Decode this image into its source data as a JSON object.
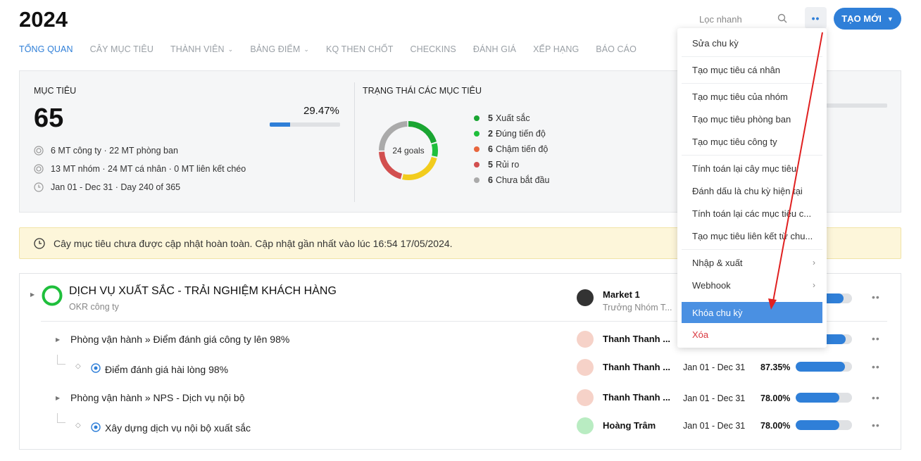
{
  "header": {
    "title": "2024",
    "search_placeholder": "Lọc nhanh",
    "more_label": "••",
    "create_label": "TẠO MỚI"
  },
  "tabs": [
    {
      "label": "TỔNG QUAN",
      "active": true
    },
    {
      "label": "CÂY MỤC TIÊU"
    },
    {
      "label": "THÀNH VIÊN",
      "dropdown": true
    },
    {
      "label": "BẢNG ĐIỂM",
      "dropdown": true
    },
    {
      "label": "KQ THEN CHỐT"
    },
    {
      "label": "CHECKINS"
    },
    {
      "label": "ĐÁNH GIÁ"
    },
    {
      "label": "XẾP HẠNG"
    },
    {
      "label": "BÁO CÁO"
    }
  ],
  "summary": {
    "goals_label": "MỤC TIÊU",
    "goals_count": "65",
    "progress_pct": "29.47%",
    "progress_value": 0.2947,
    "meta": [
      "6 MT công ty · 22 MT phòng ban",
      "13 MT nhóm · 24 MT cá nhân · 0 MT liên kết chéo",
      "Jan 01 - Dec 31 · Day 240 of 365"
    ],
    "status_label": "TRẠNG THÁI CÁC MỤC TIÊU",
    "donut_center": "24 goals",
    "status_items": [
      {
        "count": "5",
        "label": "Xuất sắc",
        "color": "#1aa532"
      },
      {
        "count": "2",
        "label": "Đúng tiến độ",
        "color": "#1fbf3c"
      },
      {
        "count": "6",
        "label": "Chậm tiến độ",
        "color": "#e8663d"
      },
      {
        "count": "5",
        "label": "Rủi ro",
        "color": "#d24f4f"
      },
      {
        "count": "6",
        "label": "Chưa bắt đầu",
        "color": "#aaaaaa"
      }
    ]
  },
  "notice": {
    "text": "Cây mục tiêu chưa được cập nhật hoàn toàn. Cập nhật gần nhất vào lúc 16:54 17/05/2024."
  },
  "okr": {
    "title": "DỊCH VỤ XUẤT SẮC - TRẢI NGHIỆM KHÁCH HÀNG",
    "subtitle": "OKR công ty",
    "owner": "Market 1",
    "owner_role": "Trưởng Nhóm T...",
    "rows": [
      {
        "text": "Phòng vận hành » Điểm đánh giá công ty lên 98%",
        "owner": "Thanh Thanh ...",
        "date": "",
        "pct": "",
        "progress": 0.89
      },
      {
        "text": "Điểm đánh giá hài lòng 98%",
        "owner": "Thanh Thanh ...",
        "date": "Jan 01 - Dec 31",
        "pct": "87.35%",
        "progress": 0.8735
      },
      {
        "text": "Phòng vận hành » NPS - Dịch vụ nội bộ",
        "owner": "Thanh Thanh ...",
        "date": "Jan 01 - Dec 31",
        "pct": "78.00%",
        "progress": 0.78
      },
      {
        "text": "Xây dựng dịch vụ nội bộ xuất sắc",
        "owner": "Hoàng Trâm",
        "date": "Jan 01 - Dec 31",
        "pct": "78.00%",
        "progress": 0.78
      }
    ],
    "header_progress": 0.85
  },
  "menu": {
    "items": [
      "Sửa chu kỳ",
      "Tạo mục tiêu cá nhân",
      "Tạo mục tiêu của nhóm",
      "Tạo mục tiêu phòng ban",
      "Tạo mục tiêu công ty",
      "Tính toán lại cây mục tiêu",
      "Đánh dấu là chu kỳ hiện tại",
      "Tính toán lại các mục tiêu c...",
      "Tạo mục tiêu liên kết từ chu...",
      "Nhập & xuất",
      "Webhook",
      "Khóa chu kỳ",
      "Xóa"
    ]
  }
}
